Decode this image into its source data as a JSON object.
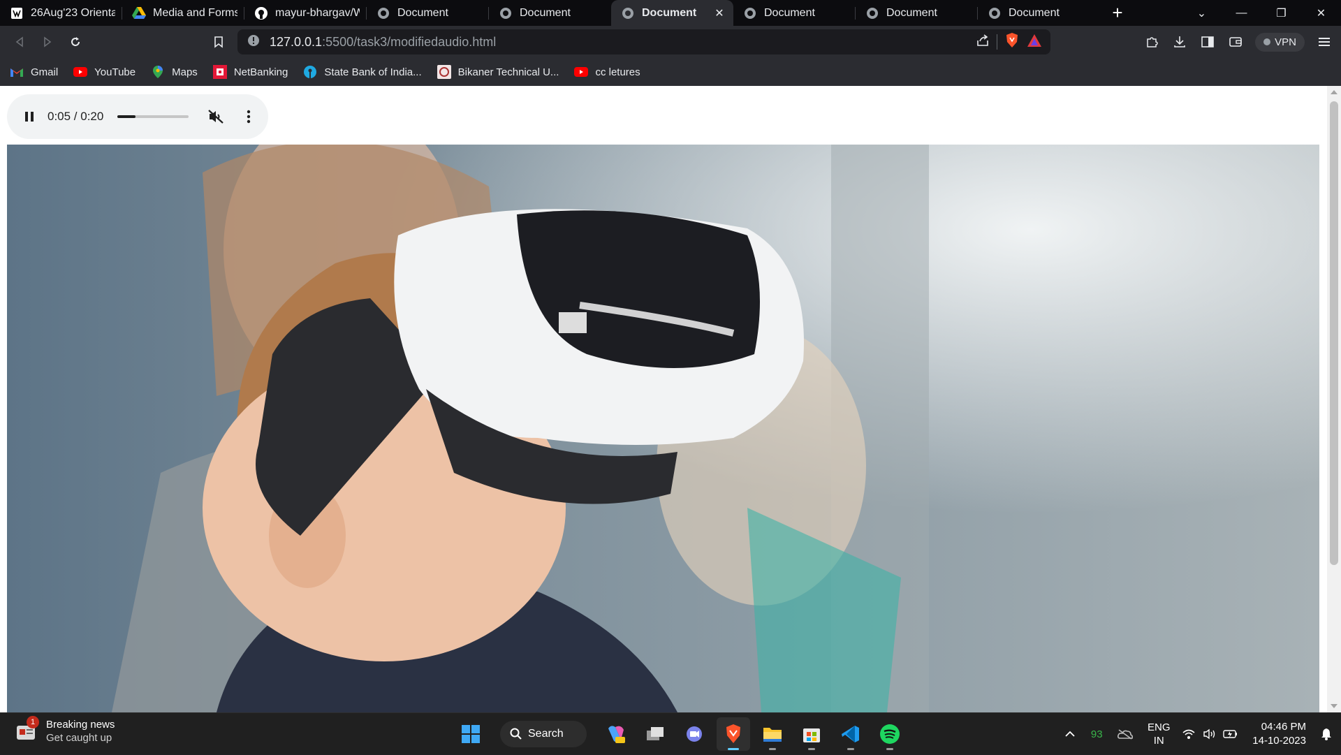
{
  "browser": {
    "tabs": [
      {
        "title": "26Aug'23 Orientatio",
        "icon": "app-icon",
        "active": false
      },
      {
        "title": "Media and Forms A",
        "icon": "google-drive-icon",
        "active": false
      },
      {
        "title": "mayur-bhargav/We",
        "icon": "github-icon",
        "active": false
      },
      {
        "title": "Document",
        "icon": "globe-icon",
        "active": false
      },
      {
        "title": "Document",
        "icon": "globe-icon",
        "active": false
      },
      {
        "title": "Document",
        "icon": "globe-icon",
        "active": true
      },
      {
        "title": "Document",
        "icon": "globe-icon",
        "active": false
      },
      {
        "title": "Document",
        "icon": "globe-icon",
        "active": false
      },
      {
        "title": "Document",
        "icon": "globe-icon",
        "active": false
      }
    ],
    "url": {
      "host": "127.0.0.1",
      "rest": ":5500/task3/modifiedaudio.html"
    },
    "vpn_label": "VPN",
    "bookmarks": [
      {
        "label": "Gmail",
        "icon": "gmail-icon"
      },
      {
        "label": "YouTube",
        "icon": "youtube-icon"
      },
      {
        "label": "Maps",
        "icon": "maps-icon"
      },
      {
        "label": "NetBanking",
        "icon": "bank-icon"
      },
      {
        "label": "State Bank of India...",
        "icon": "sbi-icon"
      },
      {
        "label": "Bikaner Technical U...",
        "icon": "university-icon"
      },
      {
        "label": "cc letures",
        "icon": "youtube-icon"
      }
    ]
  },
  "audio": {
    "time": "0:05 / 0:20",
    "progress": 0.25,
    "state": "playing",
    "muted": true
  },
  "video": {
    "description": "Child wearing a white VR headset, girl in background"
  },
  "taskbar": {
    "news_title": "Breaking news",
    "news_subtitle": "Get caught up",
    "news_badge": "1",
    "search_label": "Search",
    "tray_number": "93",
    "lang_line1": "ENG",
    "lang_line2": "IN",
    "time": "04:46 PM",
    "date": "14-10-2023"
  },
  "colors": {
    "accent": "#60cdff",
    "brave": "#fb542b"
  }
}
